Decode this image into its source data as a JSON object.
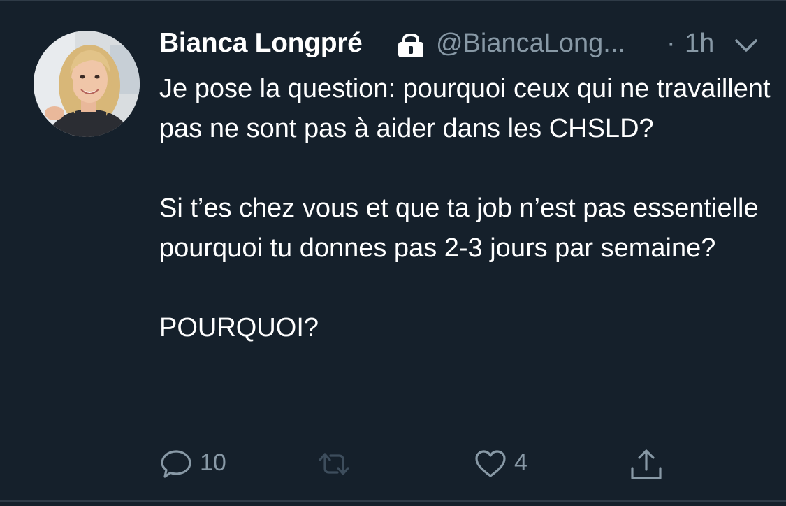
{
  "tweet": {
    "author_name": "Bianca Longpré",
    "author_handle": "@BiancaLong...",
    "separator": "·",
    "time": "1h",
    "paragraphs": [
      "Je pose la question: pourquoi ceux qui ne travaillent pas ne sont pas à aider dans les CHSLD?",
      "Si t’es chez vous et que ta job n’est pas essentielle pourquoi tu donnes pas 2-3 jours par semaine?",
      "POURQUOI?"
    ]
  },
  "actions": {
    "reply_count": "10",
    "retweet_count": "",
    "like_count": "4"
  },
  "icons": {
    "protected": "lock-icon",
    "menu": "chevron-down-icon",
    "reply": "reply-icon",
    "retweet": "retweet-icon",
    "like": "heart-icon",
    "share": "share-icon"
  },
  "colors": {
    "background": "#15202b",
    "primary_text": "#ffffff",
    "secondary_text": "#8899a6",
    "divider": "#2f3b47"
  }
}
